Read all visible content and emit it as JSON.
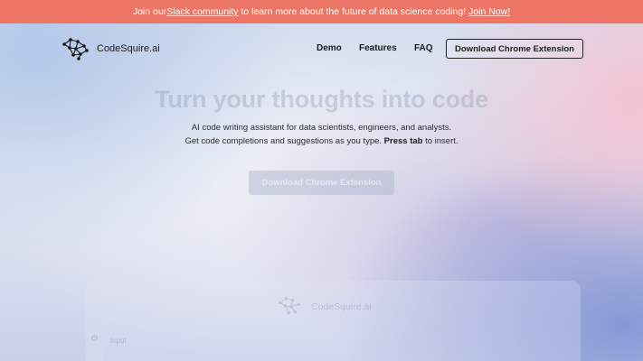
{
  "announcement": {
    "prefix": "Join our ",
    "link1": "Slack community",
    "middle": " to learn more about the future of data science coding! ",
    "link2": "Join Now!"
  },
  "nav": {
    "brand": "CodeSquire.ai",
    "links": [
      "Demo",
      "Features",
      "FAQ"
    ],
    "cta": "Download Chrome Extension"
  },
  "hero": {
    "title": "Turn your thoughts into code",
    "line1": "AI code writing assistant for data scientists, engineers, and analysts.",
    "line2_prefix": "Get code completions and suggestions as you type. ",
    "line2_bold": "Press tab",
    "line2_suffix": " to insert.",
    "cta": "Download Chrome Extension"
  },
  "demo": {
    "brand": "CodeSquire.ai",
    "input_text": "Input"
  },
  "colors": {
    "announcement_bg": "#ec7565",
    "text_dark": "#1b1b1b"
  },
  "icons": {
    "logo": "network-graph-icon",
    "settings": "gear-icon"
  }
}
